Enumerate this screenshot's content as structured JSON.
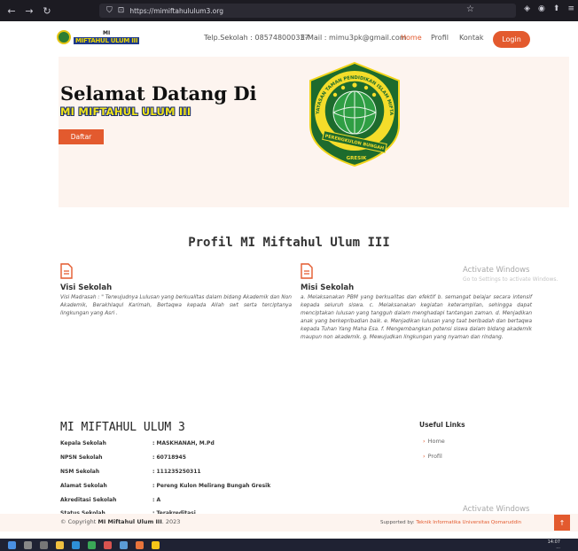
{
  "browser": {
    "url": "https://mimiftahululum3.org",
    "back_icon": "←",
    "forward_icon": "→",
    "reload_icon": "↻",
    "shield_icon": "🛡",
    "lock_icon": "🔒",
    "star_icon": "☆",
    "right_icons": [
      "pocket-icon",
      "account-icon",
      "extensions-icon",
      "menu-icon"
    ]
  },
  "header": {
    "logo_top": "MI",
    "logo_bottom": "MIFTAHUL ULUM III",
    "tel": "Telp.Sekolah : 085748000337",
    "email": "E-Mail : mimu3pk@gmail.com",
    "nav": [
      "Home",
      "Profil",
      "Kontak"
    ],
    "login": "Login"
  },
  "hero": {
    "title": "Selamat Datang Di",
    "subtitle": "MI MIFTAHUL ULUM III",
    "button": "Daftar",
    "emblem_ring_text": "YAYASAN TAMAN PENDIDIKAN ISLAM MIFTAHUL ULUM III",
    "emblem_banner": "PERENGKULON BUNGAH",
    "emblem_bottom": "GRESIK"
  },
  "profil": {
    "title": "Profil MI Miftahul Ulum III",
    "visi_title": "Visi Sekolah",
    "visi_text": "Visi Madrasah : \" Terwujudnya Lulusan yang berkualitas dalam bidang Akademik dan Non Akademik, Berakhlaqul Karimah, Bertaqwa kepada Allah swt serta terciptanya lingkungan yang Asri .",
    "misi_title": "Misi Sekolah",
    "misi_text": "a. Melaksanakan PBM yang berkualitas dan efektif b. semangat belajar secara intensif kepada seluruh siswa. c. Melaksanakan kegiatan keterampilan, sehingga dapat menciptakan lulusan yang tangguh dalam menghadapi tantangan zaman. d. Menjadikan anak yang berkepribadian baik. e. Menjadikan lulusan yang taat beribadah dan bertaqwa kepada Tuhan Yang Maha Esa. f. Mengembangkan potensi siswa dalam bidang akademik maupun non akademik. g. Mewujudkan lingkungan yang nyaman dan rindang."
  },
  "watermark": {
    "title": "Activate Windows",
    "sub": "Go to Settings to activate Windows."
  },
  "footer": {
    "school_name": "MI MIFTAHUL ULUM 3",
    "rows": [
      {
        "label": "Kepala Sekolah",
        "value": ": MASKHANAH, M.Pd"
      },
      {
        "label": "NPSN Sekolah",
        "value": ": 60718945"
      },
      {
        "label": "NSM Sekolah",
        "value": ": 111235250311"
      },
      {
        "label": "Alamat Sekolah",
        "value": ": Pereng Kulon Melirang Bungah Gresik"
      },
      {
        "label": "Akreditasi Sekolah",
        "value": ": A"
      },
      {
        "label": "Status Sekolah",
        "value": ": Terakreditasi"
      }
    ],
    "links_title": "Useful Links",
    "links": [
      "Home",
      "Profil"
    ],
    "copyright_prefix": "© Copyright",
    "copyright_name": "MI Miftahul Ulum III",
    "copyright_year": ". 2023",
    "supported_prefix": "Supported by:",
    "supported_name": "Teknik Informatika Universitas Qomaruddin"
  },
  "taskbar": {
    "time": "14:07",
    "date": "..."
  },
  "colors": {
    "accent": "#e35a2e",
    "hero_bg": "#fdf4ef",
    "chrome_bg": "#1c1b22"
  }
}
